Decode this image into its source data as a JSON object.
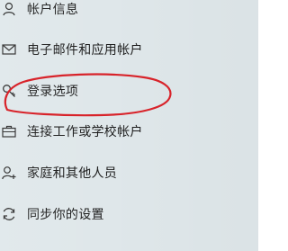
{
  "nav": {
    "items": [
      {
        "label": "帐户信息",
        "icon": "person-icon"
      },
      {
        "label": "电子邮件和应用帐户",
        "icon": "mail-icon"
      },
      {
        "label": "登录选项",
        "icon": "key-icon"
      },
      {
        "label": "连接工作或学校帐户",
        "icon": "briefcase-icon"
      },
      {
        "label": "家庭和其他人员",
        "icon": "add-person-icon"
      },
      {
        "label": "同步你的设置",
        "icon": "sync-icon"
      }
    ]
  },
  "annotation": {
    "shape": "ellipse",
    "color": "#d8232a",
    "highlights": "登录选项"
  },
  "colors": {
    "pane_background": "#dfe7ea",
    "text": "#1c1c1c",
    "icon": "#2b2b2b"
  }
}
